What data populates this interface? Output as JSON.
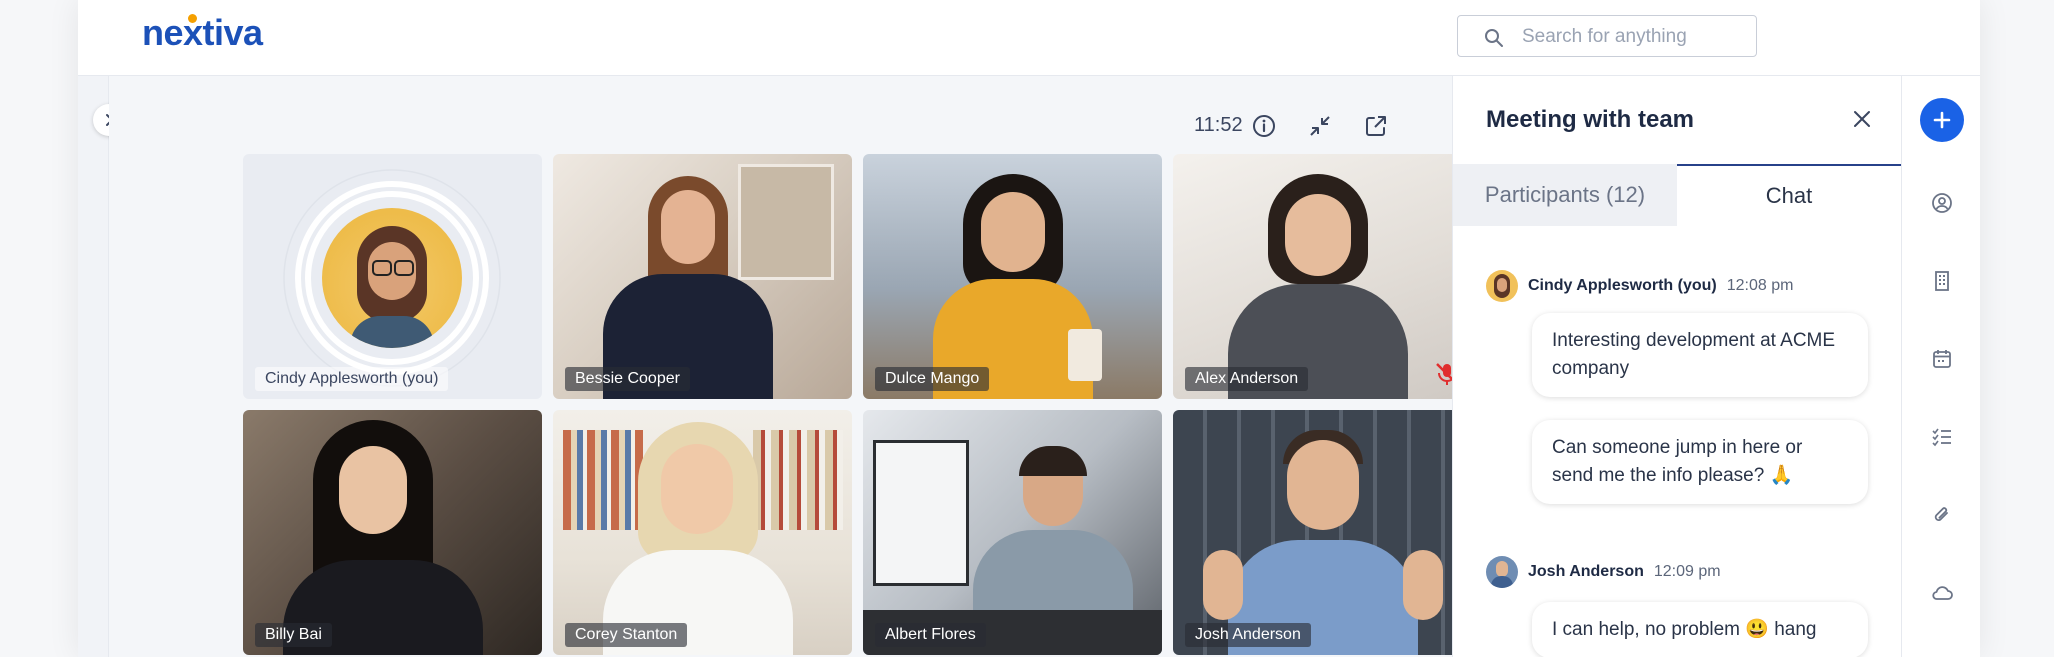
{
  "app": {
    "brand": "nextiva"
  },
  "search": {
    "placeholder": "Search for anything"
  },
  "stage": {
    "timer": "11:52"
  },
  "participants": [
    {
      "name": "Cindy Applesworth (you)",
      "style": "self"
    },
    {
      "name": "Bessie Cooper"
    },
    {
      "name": "Dulce Mango"
    },
    {
      "name": "Alex Anderson",
      "muted": true
    },
    {
      "name": "Billy Bai"
    },
    {
      "name": "Corey Stanton"
    },
    {
      "name": "Albert Flores"
    },
    {
      "name": "Josh Anderson"
    }
  ],
  "panel": {
    "title": "Meeting with team",
    "tabs": [
      {
        "label": "Participants (12)",
        "active": false
      },
      {
        "label": "Chat",
        "active": true
      }
    ]
  },
  "chat": [
    {
      "author": "Cindy Applesworth (you)",
      "time": "12:08 pm",
      "messages": [
        "Interesting development at ACME company",
        "Can someone jump in here or send me the info please? 🙏"
      ]
    },
    {
      "author": "Josh Anderson",
      "time": "12:09 pm",
      "messages": [
        "I can help, no problem 😃 hang"
      ]
    }
  ],
  "colors": {
    "brand": "#1c51b8",
    "accent": "#1a62e6",
    "tab_underline": "#27418a"
  },
  "rail_icons": [
    "plus-icon",
    "user-circle-icon",
    "building-icon",
    "calendar-icon",
    "tasks-icon",
    "paperclip-icon",
    "cloud-icon"
  ]
}
